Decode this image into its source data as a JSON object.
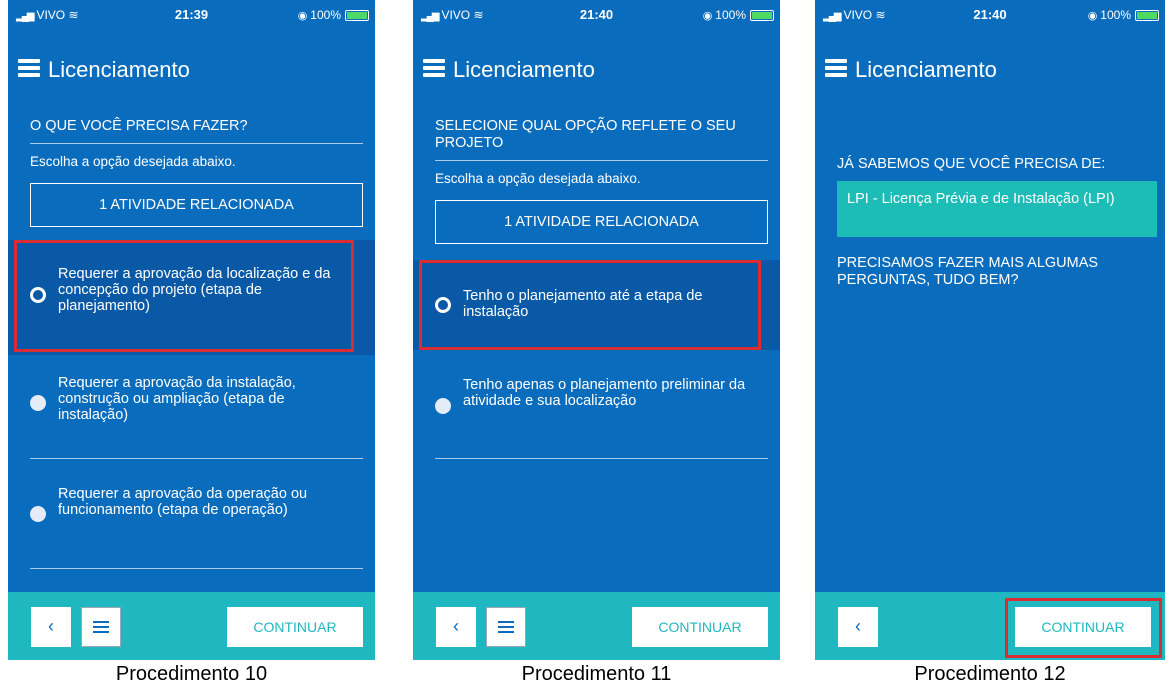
{
  "common": {
    "app_title": "Licenciamento",
    "carrier": "VIVO",
    "battery": "100%",
    "continue_label": "CONTINUAR",
    "back_icon": "chevron-left-icon",
    "menu_icon": "hamburger-icon",
    "colors": {
      "background": "#0a6cbd",
      "footer": "#1fb8c1",
      "selected_row": "#0959a6",
      "highlight": "#d72d33",
      "result_box": "#1ebcb6"
    }
  },
  "screens": [
    {
      "time": "21:39",
      "question": "O QUE VOCÊ PRECISA FAZER?",
      "hint": "Escolha a opção desejada abaixo.",
      "activity_button": "1 ATIVIDADE RELACIONADA",
      "options": [
        {
          "label": "Requerer a aprovação da localização e da concepção do projeto (etapa de planejamento)",
          "selected": true
        },
        {
          "label": "Requerer a aprovação da instalação, construção ou ampliação (etapa de instalação)",
          "selected": false
        },
        {
          "label": "Requerer a aprovação da operação ou funcionamento (etapa de operação)",
          "selected": false
        }
      ],
      "caption": "Procedimento 10"
    },
    {
      "time": "21:40",
      "question": "SELECIONE QUAL OPÇÃO REFLETE O SEU PROJETO",
      "hint": "Escolha a opção desejada abaixo.",
      "activity_button": "1 ATIVIDADE RELACIONADA",
      "options": [
        {
          "label": "Tenho o planejamento até a etapa de instalação",
          "selected": true
        },
        {
          "label": "Tenho apenas o planejamento preliminar da atividade e sua localização",
          "selected": false
        }
      ],
      "caption": "Procedimento 11"
    },
    {
      "time": "21:40",
      "known_label": "JÁ SABEMOS QUE VOCÊ PRECISA DE:",
      "licence": "LPI - Licença Prévia e de Instalação (LPI)",
      "more_questions": "PRECISAMOS FAZER MAIS ALGUMAS PERGUNTAS, TUDO BEM?",
      "caption": "Procedimento 12"
    }
  ]
}
